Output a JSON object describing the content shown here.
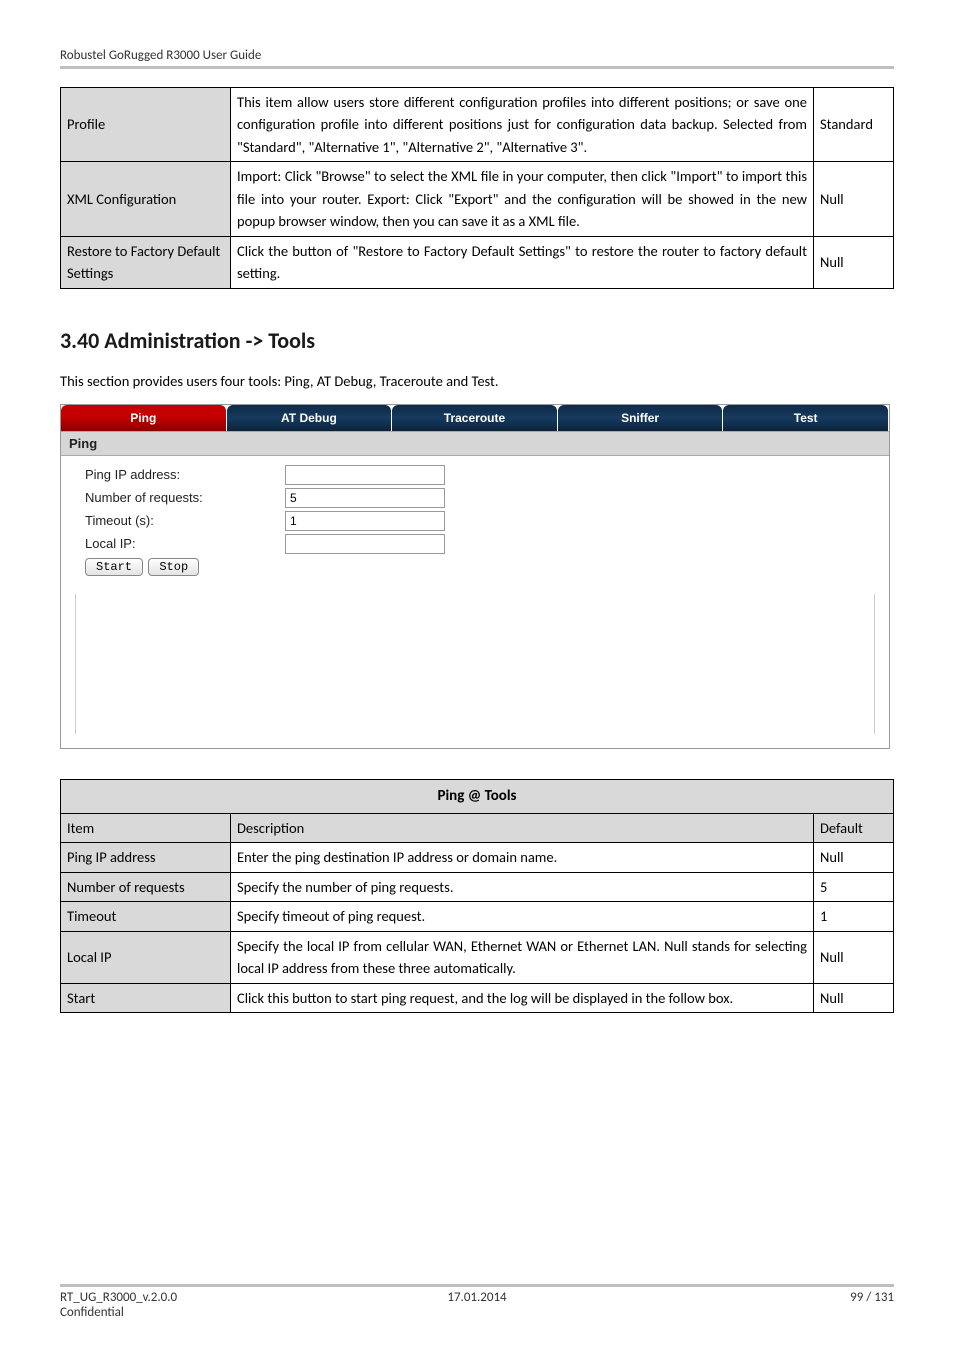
{
  "header": {
    "text": "Robustel GoRugged R3000 User Guide"
  },
  "table1": {
    "rows": [
      {
        "name": "Profile",
        "desc": "This item allow users store different configuration profiles into different positions; or save one configuration profile into different positions just for configuration data backup.\nSelected from \"Standard\", \"Alternative 1\", \"Alternative 2\", \"Alternative 3\".",
        "def": "Standard"
      },
      {
        "name": "XML Configuration",
        "desc": "Import: Click \"Browse\" to select the XML file in your computer, then click \"Import\" to import this file into your router.\nExport: Click \"Export\" and the configuration will be showed in the new popup browser window, then you can save it as a XML file.",
        "def": "Null"
      },
      {
        "name": "Restore to Factory Default Settings",
        "desc": "Click the button of \"Restore to Factory Default Settings\" to restore the router to factory default setting.",
        "def": "Null"
      }
    ]
  },
  "section_heading": "3.40  Administration -> Tools",
  "intro": "This section provides users four tools: Ping, AT Debug, Traceroute and Test.",
  "screenshot": {
    "tabs": [
      "Ping",
      "AT Debug",
      "Traceroute",
      "Sniffer",
      "Test"
    ],
    "panel_title": "Ping",
    "fields": {
      "ping_ip_label": "Ping IP address:",
      "ping_ip_value": "",
      "num_req_label": "Number of requests:",
      "num_req_value": "5",
      "timeout_label": "Timeout (s):",
      "timeout_value": "1",
      "local_ip_label": "Local IP:",
      "local_ip_value": ""
    },
    "buttons": {
      "start": "Start",
      "stop": "Stop"
    }
  },
  "table2": {
    "title": "Ping @ Tools",
    "header": {
      "item": "Item",
      "desc": "Description",
      "def": "Default"
    },
    "rows": [
      {
        "name": "Ping IP address",
        "desc": "Enter the ping destination IP address or domain name.",
        "def": "Null"
      },
      {
        "name": "Number of requests",
        "desc": "Specify the number of ping requests.",
        "def": "5"
      },
      {
        "name": "Timeout",
        "desc": "Specify timeout of ping request.",
        "def": "1"
      },
      {
        "name": "Local IP",
        "desc": "Specify the local IP from cellular WAN, Ethernet WAN or Ethernet LAN. Null stands for selecting local IP address from these three automatically.",
        "def": "Null"
      },
      {
        "name": "Start",
        "desc": "Click this button to start ping request, and the log will be displayed in the follow box.",
        "def": "Null"
      }
    ]
  },
  "footer": {
    "left_line1": "RT_UG_R3000_v.2.0.0",
    "left_line2": "Confidential",
    "center": "17.01.2014",
    "right": "99 / 131"
  }
}
